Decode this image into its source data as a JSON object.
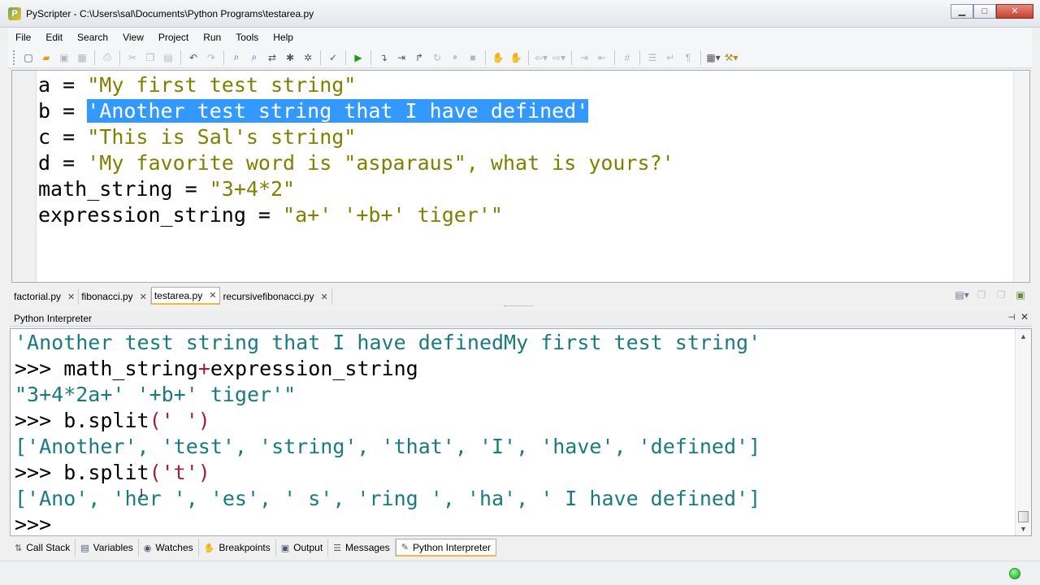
{
  "window": {
    "title": "PyScripter - C:\\Users\\sal\\Documents\\Python Programs\\testarea.py",
    "icon": "pyscripter-icon",
    "minimize": "▁",
    "maximize": "□",
    "close": "✕"
  },
  "menu": [
    "File",
    "Edit",
    "Search",
    "View",
    "Project",
    "Run",
    "Tools",
    "Help"
  ],
  "toolbar_icons": [
    "new-file-icon",
    "open-file-icon",
    "save-icon",
    "save-all-icon",
    "print-icon",
    "cut-icon",
    "copy-icon",
    "paste-icon",
    "undo-icon",
    "redo-icon",
    "find-icon",
    "find-next-icon",
    "replace-icon",
    "debug-icon",
    "bug-icon",
    "syntax-check-icon",
    "run-icon",
    "step-into-icon",
    "step-over-icon",
    "step-out-icon",
    "run-to-cursor-icon",
    "abort-icon",
    "breakpoint-icon",
    "clear-breakpoints-icon",
    "back-icon",
    "forward-icon",
    "indent-icon",
    "dedent-icon",
    "comment-icon",
    "list-icon",
    "wrap-icon",
    "pilcrow-icon",
    "layout-icon",
    "tools-icon"
  ],
  "editor": {
    "lines": [
      {
        "name": "a",
        "op": " = ",
        "value": "\"My first test string\"",
        "selected": false
      },
      {
        "name": "b",
        "op": " = ",
        "value": "'Another test string that I have defined'",
        "selected": true
      },
      {
        "name": "c",
        "op": " = ",
        "value": "\"This is Sal's string\"",
        "selected": false
      },
      {
        "name": "d",
        "op": " = ",
        "value": "'My favorite word is \"asparaus\", what is yours?'",
        "selected": false
      },
      {
        "name": "math_string",
        "op": " = ",
        "value": "\"3+4*2\"",
        "selected": false
      },
      {
        "name": "expression_string",
        "op": " = ",
        "value": "\"a+' '+b+' tiger'\"",
        "selected": false
      }
    ]
  },
  "tabs": [
    {
      "label": "factorial.py",
      "close": "✕",
      "active": false
    },
    {
      "label": "fibonacci.py",
      "close": "✕",
      "active": false
    },
    {
      "label": "testarea.py",
      "close": "✕",
      "active": true
    },
    {
      "label": "recursivefibonacci.py",
      "close": "✕",
      "active": false
    }
  ],
  "interpreter": {
    "title": "Python Interpreter",
    "pin": "⊣",
    "close": "✕",
    "lines": [
      {
        "parts": [
          {
            "t": "'Another test string that I have definedMy first test string'",
            "c": "res"
          }
        ]
      },
      {
        "parts": [
          {
            "t": ">>> ",
            "c": "prompt"
          },
          {
            "t": "math_string",
            "c": "prompt"
          },
          {
            "t": "+",
            "c": "op"
          },
          {
            "t": "expression_string",
            "c": "prompt"
          }
        ]
      },
      {
        "parts": [
          {
            "t": "\"3+4*2a+' '+b+' tiger'\"",
            "c": "res"
          }
        ]
      },
      {
        "parts": [
          {
            "t": ">>> ",
            "c": "prompt"
          },
          {
            "t": "b.split",
            "c": "prompt"
          },
          {
            "t": "(' ')",
            "c": "op"
          }
        ]
      },
      {
        "parts": [
          {
            "t": "['Another', 'test', 'string', 'that', 'I', 'have', 'defined']",
            "c": "res"
          }
        ]
      },
      {
        "parts": [
          {
            "t": ">>> ",
            "c": "prompt"
          },
          {
            "t": "b.split",
            "c": "prompt"
          },
          {
            "t": "('t')",
            "c": "op"
          }
        ]
      },
      {
        "parts": [
          {
            "t": "['Ano', 'her ', 'es', ' s', 'ring ', 'ha', ' I have defined']",
            "c": "res"
          }
        ]
      },
      {
        "parts": [
          {
            "t": ">>> ",
            "c": "prompt"
          }
        ]
      }
    ]
  },
  "dock_tabs": [
    {
      "label": "Call Stack",
      "icon": "call-stack-icon",
      "glyph": "⇅",
      "active": false
    },
    {
      "label": "Variables",
      "icon": "variables-icon",
      "glyph": "▤",
      "active": false
    },
    {
      "label": "Watches",
      "icon": "watches-icon",
      "glyph": "◉",
      "active": false
    },
    {
      "label": "Breakpoints",
      "icon": "breakpoints-icon",
      "glyph": "✋",
      "active": false
    },
    {
      "label": "Output",
      "icon": "output-icon",
      "glyph": "▣",
      "active": false
    },
    {
      "label": "Messages",
      "icon": "messages-icon",
      "glyph": "☰",
      "active": false
    },
    {
      "label": "Python Interpreter",
      "icon": "python-icon",
      "glyph": "✎",
      "active": true
    }
  ],
  "status": {
    "indicator_color": "#1a9e1a"
  }
}
